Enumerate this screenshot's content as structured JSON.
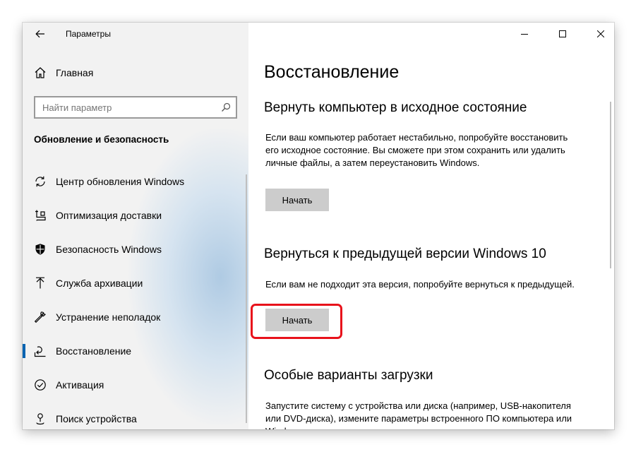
{
  "window": {
    "title": "Параметры"
  },
  "sidebar": {
    "home_label": "Главная",
    "search_placeholder": "Найти параметр",
    "section_title": "Обновление и безопасность",
    "items": [
      {
        "label": "Центр обновления Windows",
        "icon": "sync-icon"
      },
      {
        "label": "Оптимизация доставки",
        "icon": "delivery-icon"
      },
      {
        "label": "Безопасность Windows",
        "icon": "shield-icon"
      },
      {
        "label": "Служба архивации",
        "icon": "backup-arrow-icon"
      },
      {
        "label": "Устранение неполадок",
        "icon": "wrench-icon"
      },
      {
        "label": "Восстановление",
        "icon": "recovery-icon",
        "selected": true
      },
      {
        "label": "Активация",
        "icon": "check-circle-icon"
      },
      {
        "label": "Поиск устройства",
        "icon": "person-pin-icon"
      }
    ]
  },
  "content": {
    "page_title": "Восстановление",
    "sections": [
      {
        "heading": "Вернуть компьютер в исходное состояние",
        "description": "Если ваш компьютер работает нестабильно, попробуйте восстановить его исходное состояние. Вы сможете при этом сохранить или удалить личные файлы, а затем переустановить Windows.",
        "button_label": "Начать"
      },
      {
        "heading": "Вернуться к предыдущей версии Windows 10",
        "description": "Если вам не подходит эта версия, попробуйте вернуться к предыдущей.",
        "button_label": "Начать"
      },
      {
        "heading": "Особые варианты загрузки",
        "description": "Запустите систему с устройства или диска (например, USB-накопителя или DVD-диска), измените параметры встроенного ПО компьютера или Windows"
      }
    ]
  },
  "colors": {
    "sidebar_bg": "#f2f2f2",
    "accent": "#0063b1",
    "button_bg": "#cccccc",
    "highlight": "#e8121b"
  }
}
